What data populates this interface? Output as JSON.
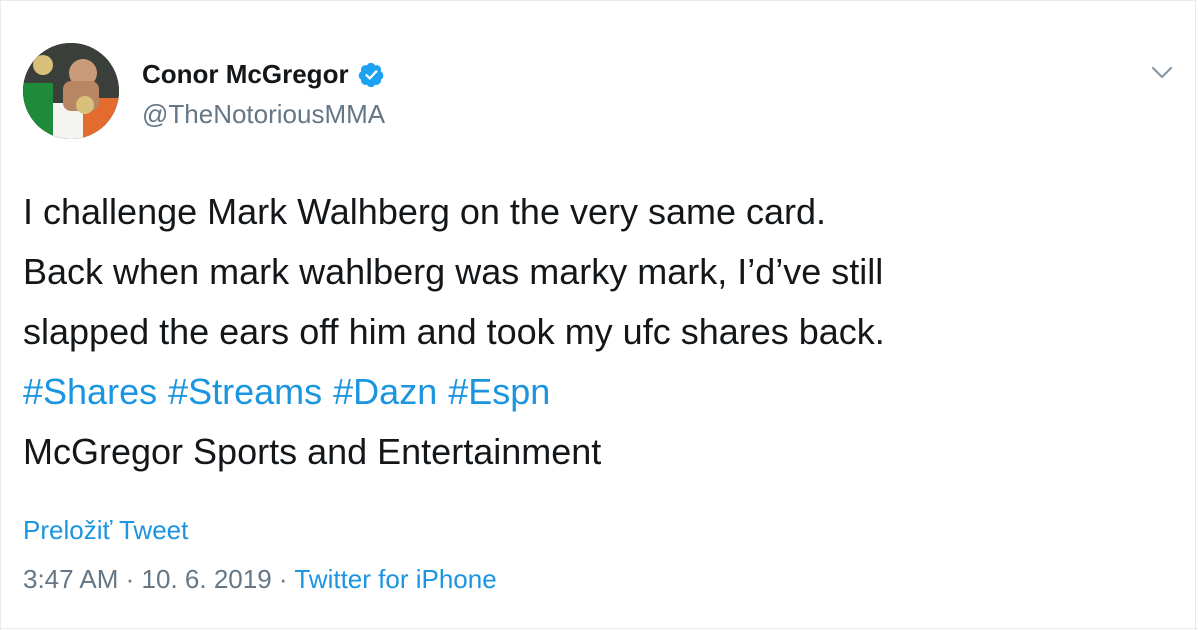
{
  "tweet": {
    "author": {
      "name": "Conor McGregor",
      "handle": "@TheNotoriousMMA",
      "verified": true
    },
    "lines": [
      "I challenge Mark Walhberg on the very same card.",
      "Back when mark wahlberg was marky mark, I’d’ve still",
      "slapped the ears off him and took my ufc shares back."
    ],
    "hashtags": [
      "#Shares",
      "#Streams",
      "#Dazn",
      "#Espn"
    ],
    "signature": "McGregor Sports and Entertainment",
    "translate_label": "Preložiť Tweet",
    "time": "3:47 AM",
    "separator": "·",
    "date": "10. 6. 2019",
    "source": "Twitter for iPhone"
  },
  "icons": {
    "verified": "verified-badge-icon",
    "menu": "chevron-down-icon"
  },
  "colors": {
    "link": "#1b95e0",
    "secondary_text": "#657786",
    "primary_text": "#14171a",
    "verified": "#1da1f2"
  }
}
